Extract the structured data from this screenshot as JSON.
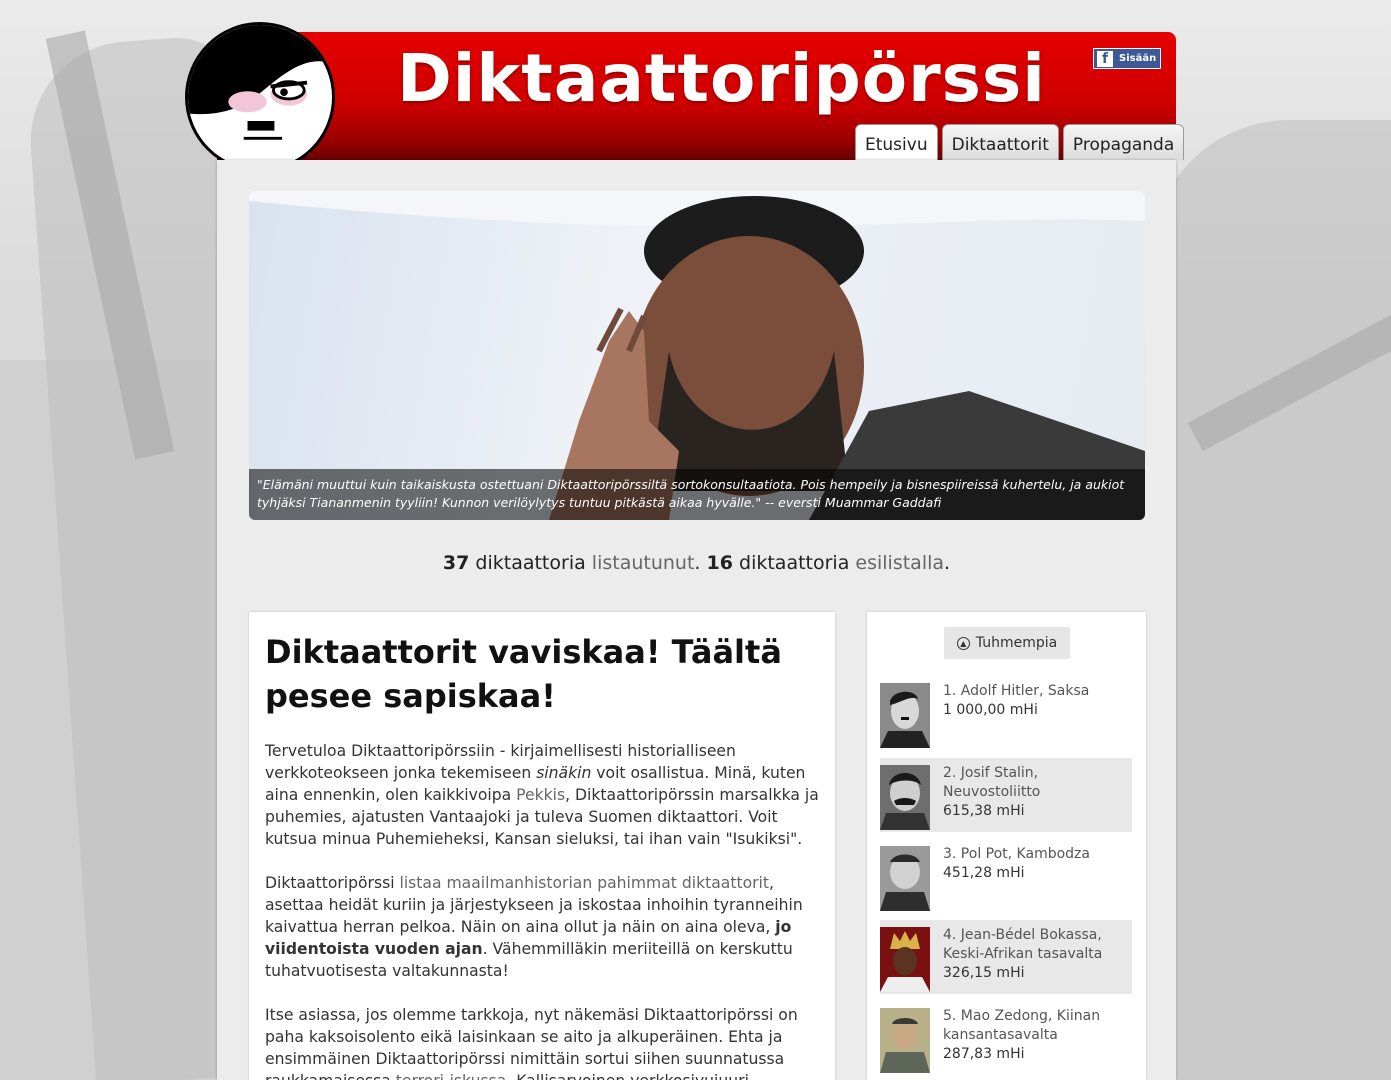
{
  "site": {
    "title": "Diktaattoripörssi"
  },
  "facebook": {
    "label": "Sisään"
  },
  "tabs": [
    {
      "label": "Etusivu"
    },
    {
      "label": "Diktaattorit"
    },
    {
      "label": "Propaganda"
    }
  ],
  "hero": {
    "caption": "\"Elämäni muuttui kuin taikaiskusta ostettuani Diktaattoripörssiltä sortokonsultaatiota. Pois hempeily ja bisnespiireissä kuhertelu, ja aukiot tyhjäksi Tiananmenin tyyliin! Kunnon verilöylytys tuntuu pitkästä aikaa hyvälle.\" -- eversti Muammar Gaddafi"
  },
  "stats": {
    "listed_count": "37",
    "listed_text": "diktaattoria",
    "listed_link": "listautunut",
    "pre_count": "16",
    "pre_text": "diktaattoria",
    "pre_link": "esilistalla"
  },
  "article": {
    "heading": "Diktaattorit vaviskaa! Täältä pesee sapiskaa!",
    "p1_a": "Tervetuloa Diktaattoripörssiin - kirjaimellisesti historialliseen verkkoteokseen jonka tekemiseen ",
    "p1_em": "sinäkin",
    "p1_b": " voit osallistua. Minä, kuten aina ennenkin, olen kaikkivoipa ",
    "p1_link": "Pekkis",
    "p1_c": ", Diktaattoripörssin marsalkka ja puhemies, ajatusten Vantaajoki ja tuleva Suomen diktaattori. Voit kutsua minua Puhemieheksi, Kansan sieluksi, tai ihan vain \"Isukiksi\".",
    "p2_a": "Diktaattoripörssi ",
    "p2_link": "listaa maailmanhistorian pahimmat diktaattorit",
    "p2_b": ", asettaa heidät kuriin ja järjestykseen ja iskostaa inhoihin tyranneihin kaivattua herran pelkoa. Näin on aina ollut ja näin on aina oleva, ",
    "p2_strong": "jo viidentoista vuoden ajan",
    "p2_c": ". Vähemmilläkin meriiteillä on kerskuttu tuhatvuotisesta valtakunnasta!",
    "p3_a": "Itse asiassa, jos olemme tarkkoja, nyt näkemäsi Diktaattoripörssi on paha kaksoisolento eikä laisinkaan se aito ja alkuperäinen. Ehta ja ensimmäinen Diktaattoripörssi nimittäin sortui siihen suunnatussa raukkamaisessa ",
    "p3_link": "terrori-iskussa",
    "p3_b": ". Kallisarvoinen verkkosivujuuri, kaikkien veppisivujen"
  },
  "sidebar": {
    "more_label": "Tuhmempia",
    "ranking": [
      {
        "name": "1. Adolf Hitler, Saksa",
        "score": "1 000,00 mHi"
      },
      {
        "name": "2. Josif Stalin, Neuvostoliitto",
        "score": "615,38 mHi"
      },
      {
        "name": "3. Pol Pot, Kambodza",
        "score": "451,28 mHi"
      },
      {
        "name": "4. Jean-Bédel Bokassa, Keski-Afrikan tasavalta",
        "score": "326,15 mHi"
      },
      {
        "name": "5. Mao Zedong, Kiinan kansantasavalta",
        "score": "287,83 mHi"
      }
    ]
  },
  "colors": {
    "brand_red": "#cf0000",
    "facebook": "#3b5998"
  }
}
